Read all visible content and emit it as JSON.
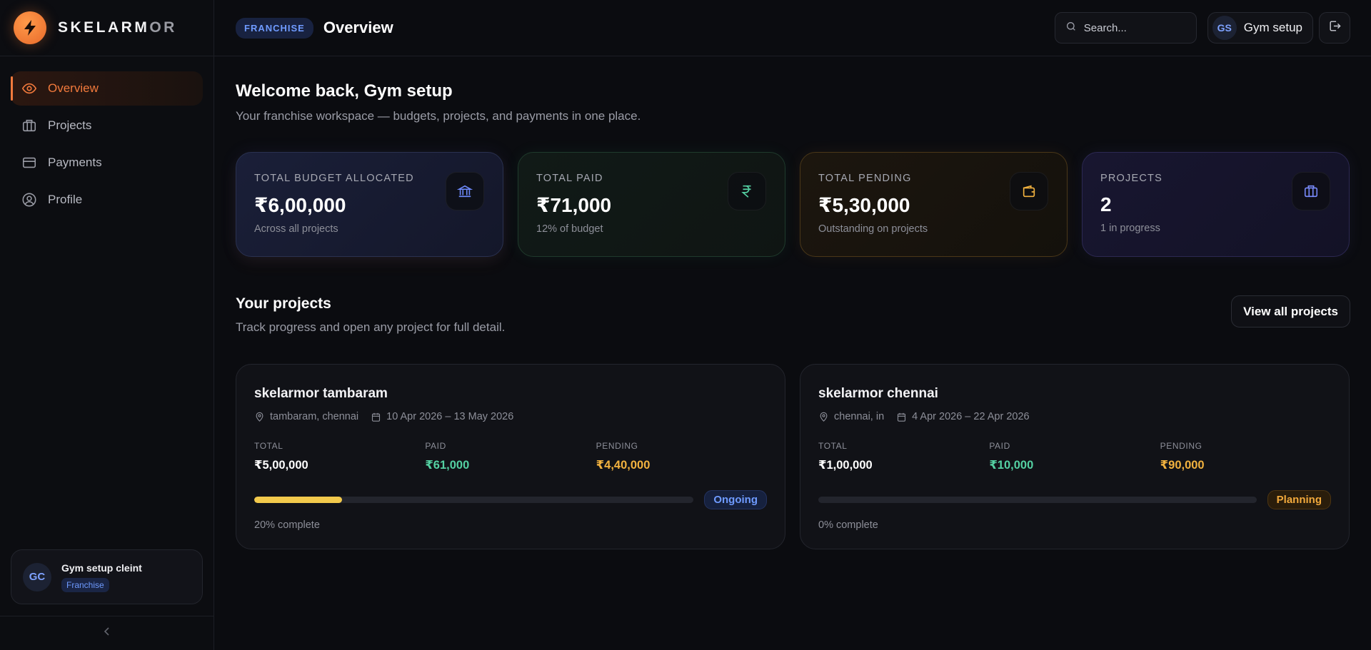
{
  "brand": {
    "name_main": "SKELARM",
    "name_dim": "OR"
  },
  "sidebar": {
    "items": [
      {
        "label": "Overview",
        "icon": "eye-icon",
        "active": true
      },
      {
        "label": "Projects",
        "icon": "briefcase-icon",
        "active": false
      },
      {
        "label": "Payments",
        "icon": "credit-card-icon",
        "active": false
      },
      {
        "label": "Profile",
        "icon": "user-circle-icon",
        "active": false
      }
    ],
    "user": {
      "initials": "GC",
      "name": "Gym setup cleint",
      "role": "Franchise"
    }
  },
  "header": {
    "badge": "FRANCHISE",
    "title": "Overview",
    "search_placeholder": "Search...",
    "user": {
      "initials": "GS",
      "name": "Gym setup"
    }
  },
  "welcome": {
    "title": "Welcome back, Gym setup",
    "subtitle": "Your franchise workspace — budgets, projects, and payments in one place."
  },
  "stats": [
    {
      "label": "TOTAL BUDGET ALLOCATED",
      "value": "₹6,00,000",
      "sub": "Across all projects",
      "icon": "bank-icon",
      "accent": "#6f8cff"
    },
    {
      "label": "TOTAL PAID",
      "value": "₹71,000",
      "sub": "12% of budget",
      "icon": "rupee-icon",
      "accent": "#54d0a2"
    },
    {
      "label": "TOTAL PENDING",
      "value": "₹5,30,000",
      "sub": "Outstanding on projects",
      "icon": "wallet-icon",
      "accent": "#f2b23f"
    },
    {
      "label": "PROJECTS",
      "value": "2",
      "sub": "1 in progress",
      "icon": "briefcase-icon",
      "accent": "#7a8cff"
    }
  ],
  "projects": {
    "title": "Your projects",
    "subtitle": "Track progress and open any project for full detail.",
    "view_all": "View all projects",
    "labels": {
      "total": "TOTAL",
      "paid": "PAID",
      "pending": "PENDING"
    },
    "items": [
      {
        "name": "skelarmor tambaram",
        "location": "tambaram, chennai",
        "dates": "10 Apr 2026 – 13 May 2026",
        "total": "₹5,00,000",
        "paid": "₹61,000",
        "pending": "₹4,40,000",
        "progress": 0.2,
        "status": "Ongoing",
        "complete": "20% complete"
      },
      {
        "name": "skelarmor chennai",
        "location": "chennai, in",
        "dates": "4 Apr 2026 – 22 Apr 2026",
        "total": "₹1,00,000",
        "paid": "₹10,000",
        "pending": "₹90,000",
        "progress": 0,
        "status": "Planning",
        "complete": "0% complete"
      }
    ]
  },
  "colors": {
    "accent": "#f27a3c",
    "paid": "#54d0a2",
    "pending": "#f2b23f",
    "progress_fill": "#f2c94c",
    "ongoing": "#6f9bff"
  }
}
